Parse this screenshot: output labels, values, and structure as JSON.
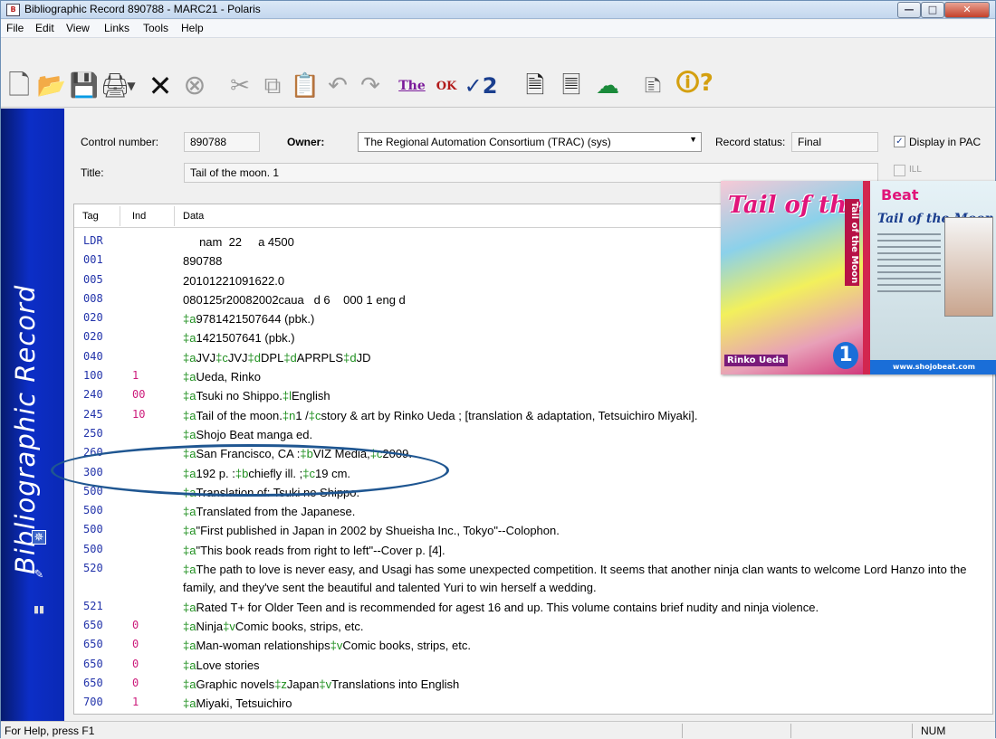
{
  "window": {
    "title": "Bibliographic Record 890788 - MARC21 - Polaris",
    "app_icon": "B",
    "controls": [
      "minimize",
      "maximize",
      "close"
    ]
  },
  "menu": [
    "File",
    "Edit",
    "View",
    "Links",
    "Tools",
    "Help"
  ],
  "toolbar": {
    "icons": [
      "new-document-icon",
      "open-folder-icon",
      "save-icon",
      "print-icon",
      "delete-icon",
      "cancel-icon",
      "cut-icon",
      "copy-icon",
      "paste-icon",
      "undo-icon",
      "redo-icon",
      "validate-icon",
      "ok-icon",
      "spellcheck-icon",
      "duplicate-icon",
      "record-icon",
      "link-icon",
      "properties-icon",
      "help-icon"
    ]
  },
  "banner": {
    "text": "Bibliographic Record"
  },
  "header": {
    "control_number_label": "Control number:",
    "control_number": "890788",
    "owner_label": "Owner:",
    "owner": "The Regional Automation Consortium (TRAC) (sys)",
    "record_status_label": "Record status:",
    "record_status": "Final",
    "display_in_pac_label": "Display in PAC",
    "display_in_pac_checked": true,
    "title_label": "Title:",
    "title": "Tail of the moon. 1",
    "ill_label": "ILL",
    "ill_checked": false
  },
  "grid": {
    "columns": [
      "Tag",
      "Ind",
      "Data"
    ],
    "rows": [
      {
        "tag": "LDR",
        "ind": "",
        "data": "     nam  22     a 4500"
      },
      {
        "tag": "001",
        "ind": "",
        "data": "890788"
      },
      {
        "tag": "005",
        "ind": "",
        "data": "20101221091622.0"
      },
      {
        "tag": "008",
        "ind": "",
        "data": "080125r20082002caua   d 6    000 1 eng d"
      },
      {
        "tag": "020",
        "ind": "",
        "data": "‡a9781421507644 (pbk.)"
      },
      {
        "tag": "020",
        "ind": "",
        "data": "‡a1421507641 (pbk.)"
      },
      {
        "tag": "040",
        "ind": "",
        "data": "‡aJVJ‡cJVJ‡dDPL‡dAPRPLS‡dJD"
      },
      {
        "tag": "100",
        "ind": "1",
        "data": "‡aUeda, Rinko"
      },
      {
        "tag": "240",
        "ind": "00",
        "data": "‡aTsuki no Shippo.‡lEnglish"
      },
      {
        "tag": "245",
        "ind": "10",
        "data": "‡aTail of the moon.‡n1 /‡cstory & art by Rinko Ueda ; [translation & adaptation, Tetsuichiro Miyaki]."
      },
      {
        "tag": "250",
        "ind": "",
        "data": "‡aShojo Beat manga ed."
      },
      {
        "tag": "260",
        "ind": "",
        "data": "‡aSan Francisco, CA :‡bVIZ Media,‡c2009."
      },
      {
        "tag": "300",
        "ind": "",
        "data": "‡a192 p. :‡bchiefly ill. ;‡c19 cm."
      },
      {
        "tag": "500",
        "ind": "",
        "data": "‡aTranslation of: Tsuki no Shippo."
      },
      {
        "tag": "500",
        "ind": "",
        "data": "‡aTranslated from the Japanese."
      },
      {
        "tag": "500",
        "ind": "",
        "data": "‡a\"First published in Japan in 2002 by Shueisha Inc., Tokyo\"--Colophon."
      },
      {
        "tag": "500",
        "ind": "",
        "data": "‡a\"This book reads from right to left\"--Cover p. [4]."
      },
      {
        "tag": "520",
        "ind": "",
        "data": "‡aThe path to love is never easy, and Usagi has some unexpected competition. It seems that another ninja clan wants to welcome Lord Hanzo into the family, and they've sent the beautiful and talented Yuri to win herself a wedding."
      },
      {
        "tag": "521",
        "ind": "",
        "data": "‡aRated T+ for Older Teen and is recommended for agest 16 and up. This volume contains brief nudity and ninja violence."
      },
      {
        "tag": "650",
        "ind": "0",
        "data": "‡aNinja‡vComic books, strips, etc."
      },
      {
        "tag": "650",
        "ind": "0",
        "data": "‡aMan-woman relationships‡vComic books, strips, etc."
      },
      {
        "tag": "650",
        "ind": "0",
        "data": "‡aLove stories"
      },
      {
        "tag": "650",
        "ind": "0",
        "data": "‡aGraphic novels‡zJapan‡vTranslations into English"
      },
      {
        "tag": "700",
        "ind": "1",
        "data": "‡aMiyaki, Tetsuichiro"
      }
    ]
  },
  "cover": {
    "front_title": "Tail of the Moon",
    "spine_text": "Tail of the Moon",
    "author": "Rinko Ueda",
    "volume": "1",
    "back_brand": "Beat",
    "back_title": "Tail of the Moon",
    "back_url": "www.shojobeat.com"
  },
  "statusbar": {
    "help": "For Help, press F1",
    "num": "NUM"
  },
  "colors": {
    "tag": "#2233aa",
    "indicator": "#cc1a7a",
    "subfield_code": "#1f8f1f",
    "banner": "#0c2ec7",
    "highlight_ellipse": "#1f5691"
  }
}
